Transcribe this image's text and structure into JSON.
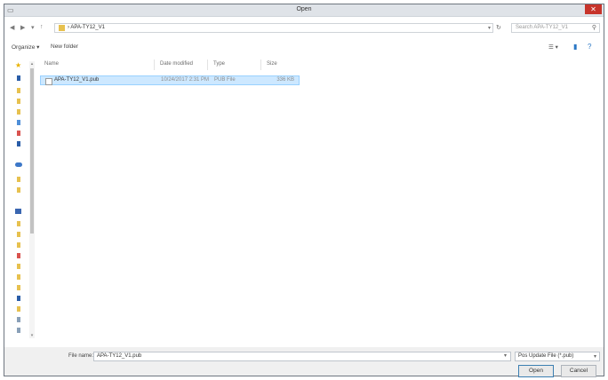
{
  "window": {
    "title": "Open",
    "close_glyph": "✕"
  },
  "nav": {
    "back": "◀",
    "forward": "▶",
    "up": "↑",
    "breadcrumb_sep": "›",
    "path": "APA-TY12_V1",
    "dropdown": "▾",
    "refresh": "↻"
  },
  "search": {
    "placeholder": "Search APA-TY12_V1",
    "icon": "⚲"
  },
  "toolbar": {
    "organize": "Organize ▾",
    "new_folder": "New folder",
    "view": "☰ ▾",
    "preview": "▮",
    "help": "?"
  },
  "columns": {
    "name": "Name",
    "date": "Date modified",
    "type": "Type",
    "size": "Size"
  },
  "files": [
    {
      "name": "APA-TY12_V1.pub",
      "date": "10/24/2017 2:31 PM",
      "type": "PUB File",
      "size": "336 KB"
    }
  ],
  "bottom": {
    "file_name_label": "File name:",
    "file_name_value": "APA-TY12_V1.pub",
    "dropdown": "▾",
    "filter": "Pos Update File (*.pub)",
    "open": "Open",
    "cancel": "Cancel"
  },
  "colors": {
    "selection": "#cde8ff",
    "selection_border": "#99d1ff",
    "close": "#c7342b",
    "folder": "#e7c14f"
  }
}
